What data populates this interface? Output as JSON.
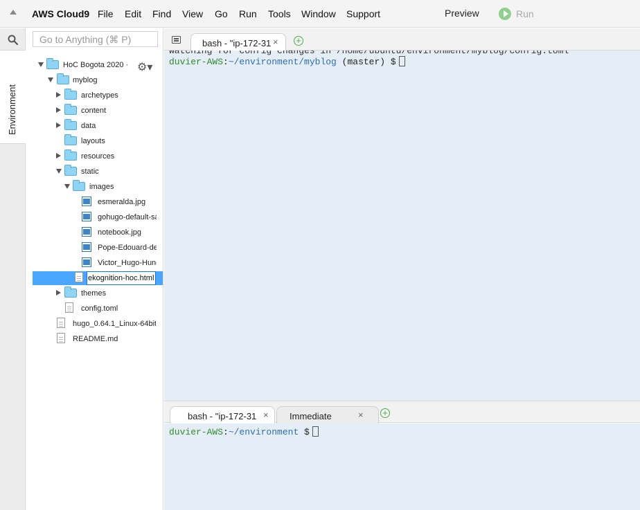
{
  "menubar": {
    "brand": "AWS Cloud9",
    "menus": [
      "File",
      "Edit",
      "Find",
      "View",
      "Go",
      "Run",
      "Tools",
      "Window",
      "Support"
    ],
    "preview": "Preview",
    "run": "Run"
  },
  "sidebar": {
    "environment_tab": "Environment",
    "goto_placeholder": "Go to Anything (⌘ P)"
  },
  "tree": {
    "root": "HoC Bogota 2020 ·",
    "items": [
      "myblog",
      "archetypes",
      "content",
      "data",
      "layouts",
      "resources",
      "static",
      "images",
      "esmeralda.jpg",
      "gohugo-default-sa",
      "notebook.jpg",
      "Pope-Edouard-de-",
      "Victor_Hugo-Hunc",
      "ekognition-hoc.html",
      "themes",
      "config.toml",
      "hugo_0.64.1_Linux-64bit",
      "README.md"
    ]
  },
  "terminal_top": {
    "tab_label": "bash - \"ip-172-31",
    "ghost": "Watching for config changes in /home/ubuntu/environment/myblog/config.toml",
    "prompt_user": "duvier-AWS",
    "prompt_path": "~/environment/myblog",
    "prompt_rest": " (master) $"
  },
  "terminal_bottom": {
    "tab_label": "bash - \"ip-172-31",
    "tab2_label": "Immediate",
    "prompt_user": "duvier-AWS",
    "prompt_path": "~/environment",
    "prompt_rest": " $"
  },
  "icons": {
    "close": "×",
    "add": "+",
    "gear": "⚙▾"
  },
  "colors": {
    "selection": "#4aa6ff",
    "terminal_bg": "#e5eef6",
    "prompt_user": "#2e8b2e",
    "prompt_path": "#2a6fb0",
    "folder": "#8ed4f5"
  }
}
